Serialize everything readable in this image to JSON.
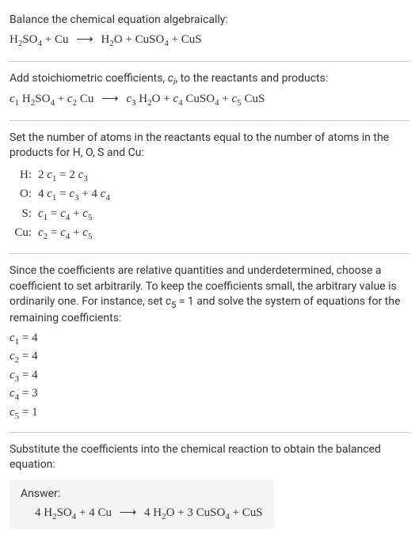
{
  "section1": {
    "prompt": "Balance the chemical equation algebraically:",
    "equation_html": "H<span class='sub'>2</span>SO<span class='sub'>4</span> + Cu <span class='arrow'>⟶</span> H<span class='sub'>2</span>O + CuSO<span class='sub'>4</span> + CuS"
  },
  "section2": {
    "prompt_html": "Add stoichiometric coefficients, <span class='ital'>c<span class='sub'>i</span></span>, to the reactants and products:",
    "equation_html": "<span class='ital'>c</span><span class='sub'>1</span> H<span class='sub'>2</span>SO<span class='sub'>4</span> + <span class='ital'>c</span><span class='sub'>2</span> Cu <span class='arrow'>⟶</span> <span class='ital'>c</span><span class='sub'>3</span> H<span class='sub'>2</span>O + <span class='ital'>c</span><span class='sub'>4</span> CuSO<span class='sub'>4</span> + <span class='ital'>c</span><span class='sub'>5</span> CuS"
  },
  "section3": {
    "prompt": "Set the number of atoms in the reactants equal to the number of atoms in the products for H, O, S and Cu:",
    "rows": [
      {
        "label": "H:",
        "eq_html": "2 <span class='ital'>c</span><span class='sub'>1</span> = 2 <span class='ital'>c</span><span class='sub'>3</span>"
      },
      {
        "label": "O:",
        "eq_html": "4 <span class='ital'>c</span><span class='sub'>1</span> = <span class='ital'>c</span><span class='sub'>3</span> + 4 <span class='ital'>c</span><span class='sub'>4</span>"
      },
      {
        "label": "S:",
        "eq_html": "<span class='ital'>c</span><span class='sub'>1</span> = <span class='ital'>c</span><span class='sub'>4</span> + <span class='ital'>c</span><span class='sub'>5</span>"
      },
      {
        "label": "Cu:",
        "eq_html": "<span class='ital'>c</span><span class='sub'>2</span> = <span class='ital'>c</span><span class='sub'>4</span> + <span class='ital'>c</span><span class='sub'>5</span>"
      }
    ]
  },
  "section4": {
    "prompt_html": "Since the coefficients are relative quantities and underdetermined, choose a coefficient to set arbitrarily. To keep the coefficients small, the arbitrary value is ordinarily one. For instance, set <span class='ital'>c</span><span class='sub'>5</span> = 1 and solve the system of equations for the remaining coefficients:",
    "coeffs": [
      "<span class='ital'>c</span><span class='sub'>1</span> = 4",
      "<span class='ital'>c</span><span class='sub'>2</span> = 4",
      "<span class='ital'>c</span><span class='sub'>3</span> = 4",
      "<span class='ital'>c</span><span class='sub'>4</span> = 3",
      "<span class='ital'>c</span><span class='sub'>5</span> = 1"
    ]
  },
  "section5": {
    "prompt": "Substitute the coefficients into the chemical reaction to obtain the balanced equation:",
    "answer_label": "Answer:",
    "answer_html": "4 H<span class='sub'>2</span>SO<span class='sub'>4</span> + 4 Cu <span class='arrow'>⟶</span> 4 H<span class='sub'>2</span>O + 3 CuSO<span class='sub'>4</span> + CuS"
  }
}
